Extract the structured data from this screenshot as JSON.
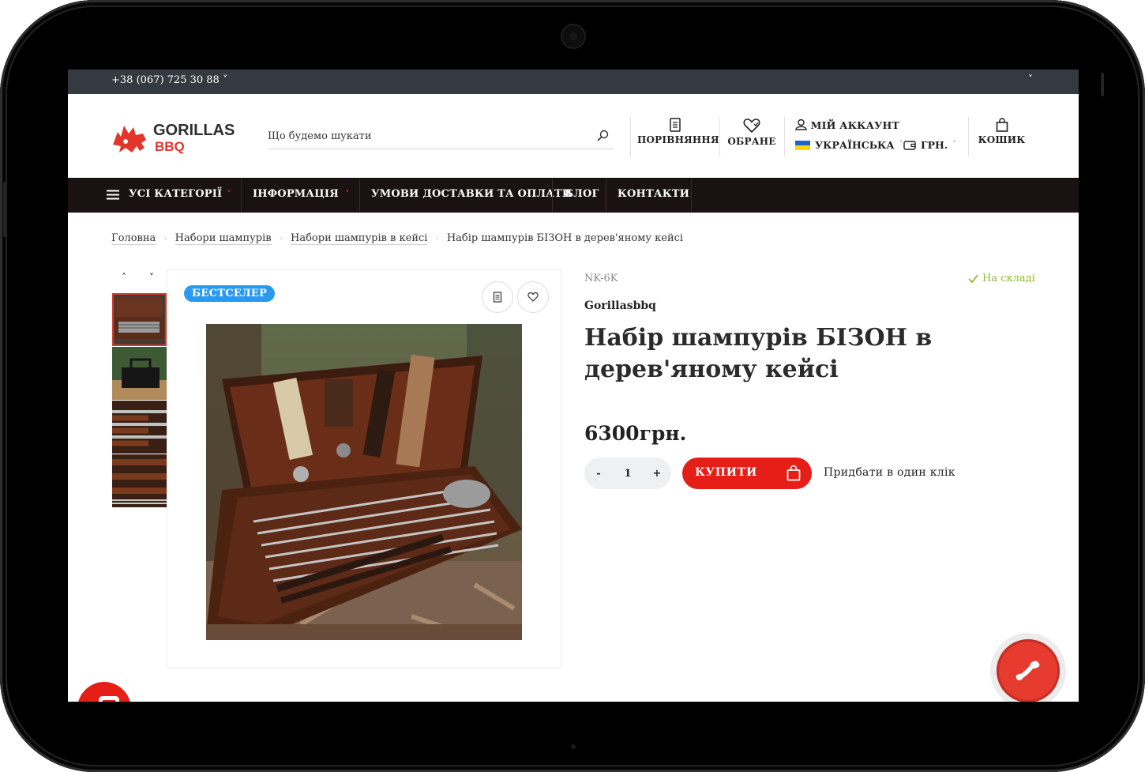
{
  "topbar": {
    "phone": "+38 (067) 725 30 88 ˅",
    "chevron": "˅"
  },
  "logo": {
    "line1": "GORILLAS",
    "line2": "BBQ"
  },
  "search": {
    "placeholder": "Що будемо шукати"
  },
  "header": {
    "compare": "ПОРІВНЯННЯ",
    "favorites": "ОБРАНЕ",
    "account": "МІЙ АККАУНТ",
    "language": "УКРАЇНСЬКА",
    "currency": "ГРН.",
    "cart": "КОШИК"
  },
  "nav": {
    "categories": "УСІ КАТЕГОРІЇ",
    "info": "ІНФОРМАЦІЯ",
    "delivery": "УМОВИ ДОСТАВКИ ТА ОПЛАТИ",
    "blog": "БЛОГ",
    "contacts": "КОНТАКТИ"
  },
  "breadcrumbs": [
    "Головна",
    "Набори шампурів",
    "Набори шампурів в кейсі",
    "Набір шампурів БІЗОН в дерев'яному кейсі"
  ],
  "product": {
    "badge": "БЕСТСЕЛЕР",
    "sku": "NK-6K",
    "stock": "На складі",
    "brand": "Gorillasbbq",
    "title": "Набір шампурів БІЗОН в дерев'яному кейсі",
    "price": "6300грн.",
    "quantity": "1",
    "qty_minus": "-",
    "qty_plus": "+",
    "buy": "КУПИТИ",
    "one_click": "Придбати в один клік"
  },
  "icons": {
    "compare": "compare-icon",
    "favorite": "heart-icon",
    "account": "user-icon",
    "currency": "wallet-icon",
    "cart": "bag-icon",
    "call": "phone-icon"
  },
  "colors": {
    "accent": "#e51f17",
    "badge": "#2a9af1",
    "nav_bg": "#1a1212",
    "topbar_bg": "#343a40",
    "stock": "#8dbb2e"
  }
}
